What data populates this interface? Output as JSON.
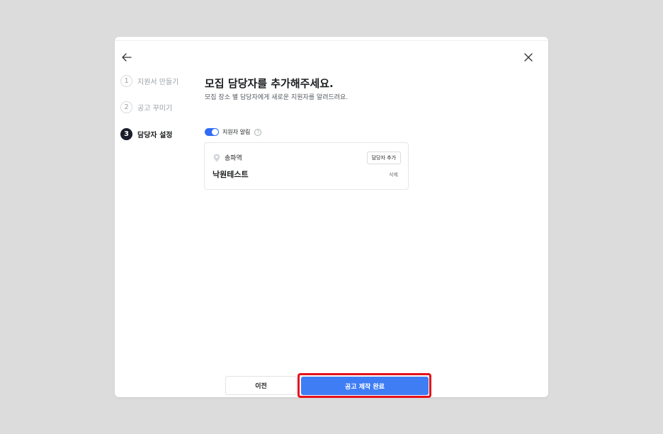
{
  "steps": [
    {
      "num": "1",
      "label": "지원서 만들기",
      "active": false
    },
    {
      "num": "2",
      "label": "공고 꾸미기",
      "active": false
    },
    {
      "num": "3",
      "label": "담당자 설정",
      "active": true
    }
  ],
  "main": {
    "title": "모집 담당자를 추가해주세요.",
    "subtitle": "모집 장소 별 담당자에게 새로운 지원자를 알려드려요."
  },
  "notification": {
    "label": "지원자 알림",
    "enabled": true,
    "help_glyph": "?"
  },
  "location_card": {
    "location": "송파역",
    "add_manager_label": "담당자 추가",
    "manager_name": "낙원테스트",
    "delete_label": "삭제"
  },
  "footer": {
    "prev_label": "이전",
    "complete_label": "공고 제작 완료"
  },
  "colors": {
    "accent": "#3f7df5",
    "toggle_on": "#2f6cf6",
    "highlight_outline": "#e5121b",
    "active_step": "#1b1d2a"
  },
  "icons": {
    "back": "arrow-left-icon",
    "close": "close-icon",
    "pin": "map-pin-icon",
    "help": "help-circle-icon"
  }
}
